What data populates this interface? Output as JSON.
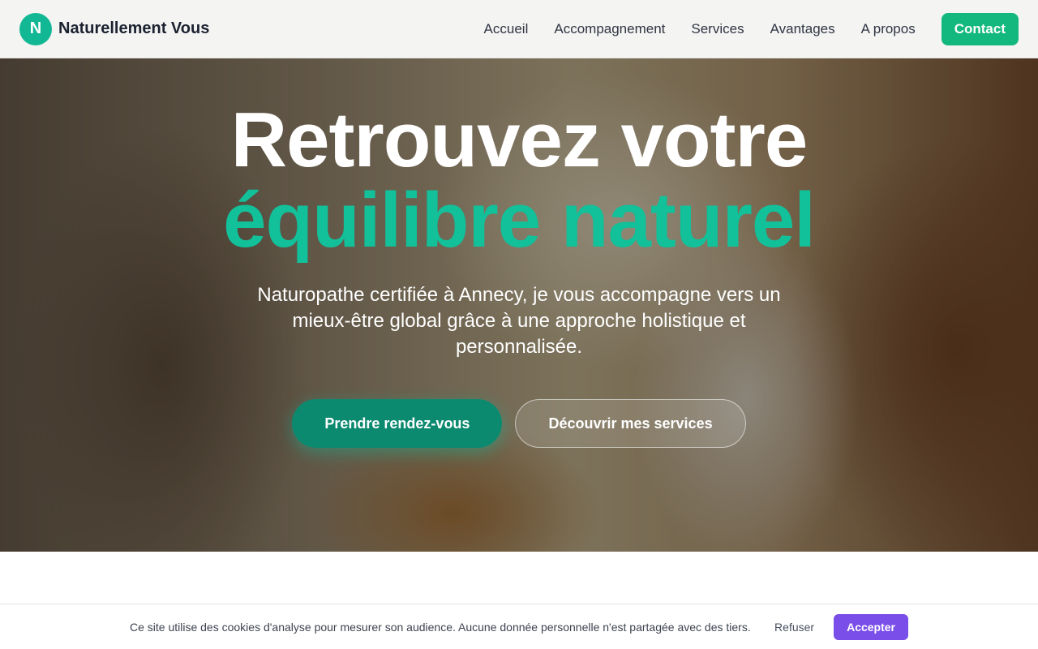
{
  "brand": {
    "logo_letter": "N",
    "name": "Naturellement Vous"
  },
  "nav": {
    "items": [
      "Accueil",
      "Accompagnement",
      "Services",
      "Avantages",
      "A propos"
    ],
    "contact_label": "Contact"
  },
  "hero": {
    "title_line1": "Retrouvez votre",
    "title_line2": "équilibre naturel",
    "subtitle": "Naturopathe certifiée à Annecy, je vous accompagne vers un mieux-être global grâce à une approche holistique et personnalisée.",
    "primary_cta": "Prendre rendez-vous",
    "secondary_cta": "Découvrir mes services"
  },
  "cookie": {
    "message": "Ce site utilise des cookies d'analyse pour mesurer son audience. Aucune donnée personnelle n'est partagée avec des tiers.",
    "refuse_label": "Refuser",
    "accept_label": "Accepter"
  },
  "colors": {
    "brand_green": "#12b894",
    "accent_text": "#12c09a",
    "accept_purple": "#7a4ee8"
  }
}
